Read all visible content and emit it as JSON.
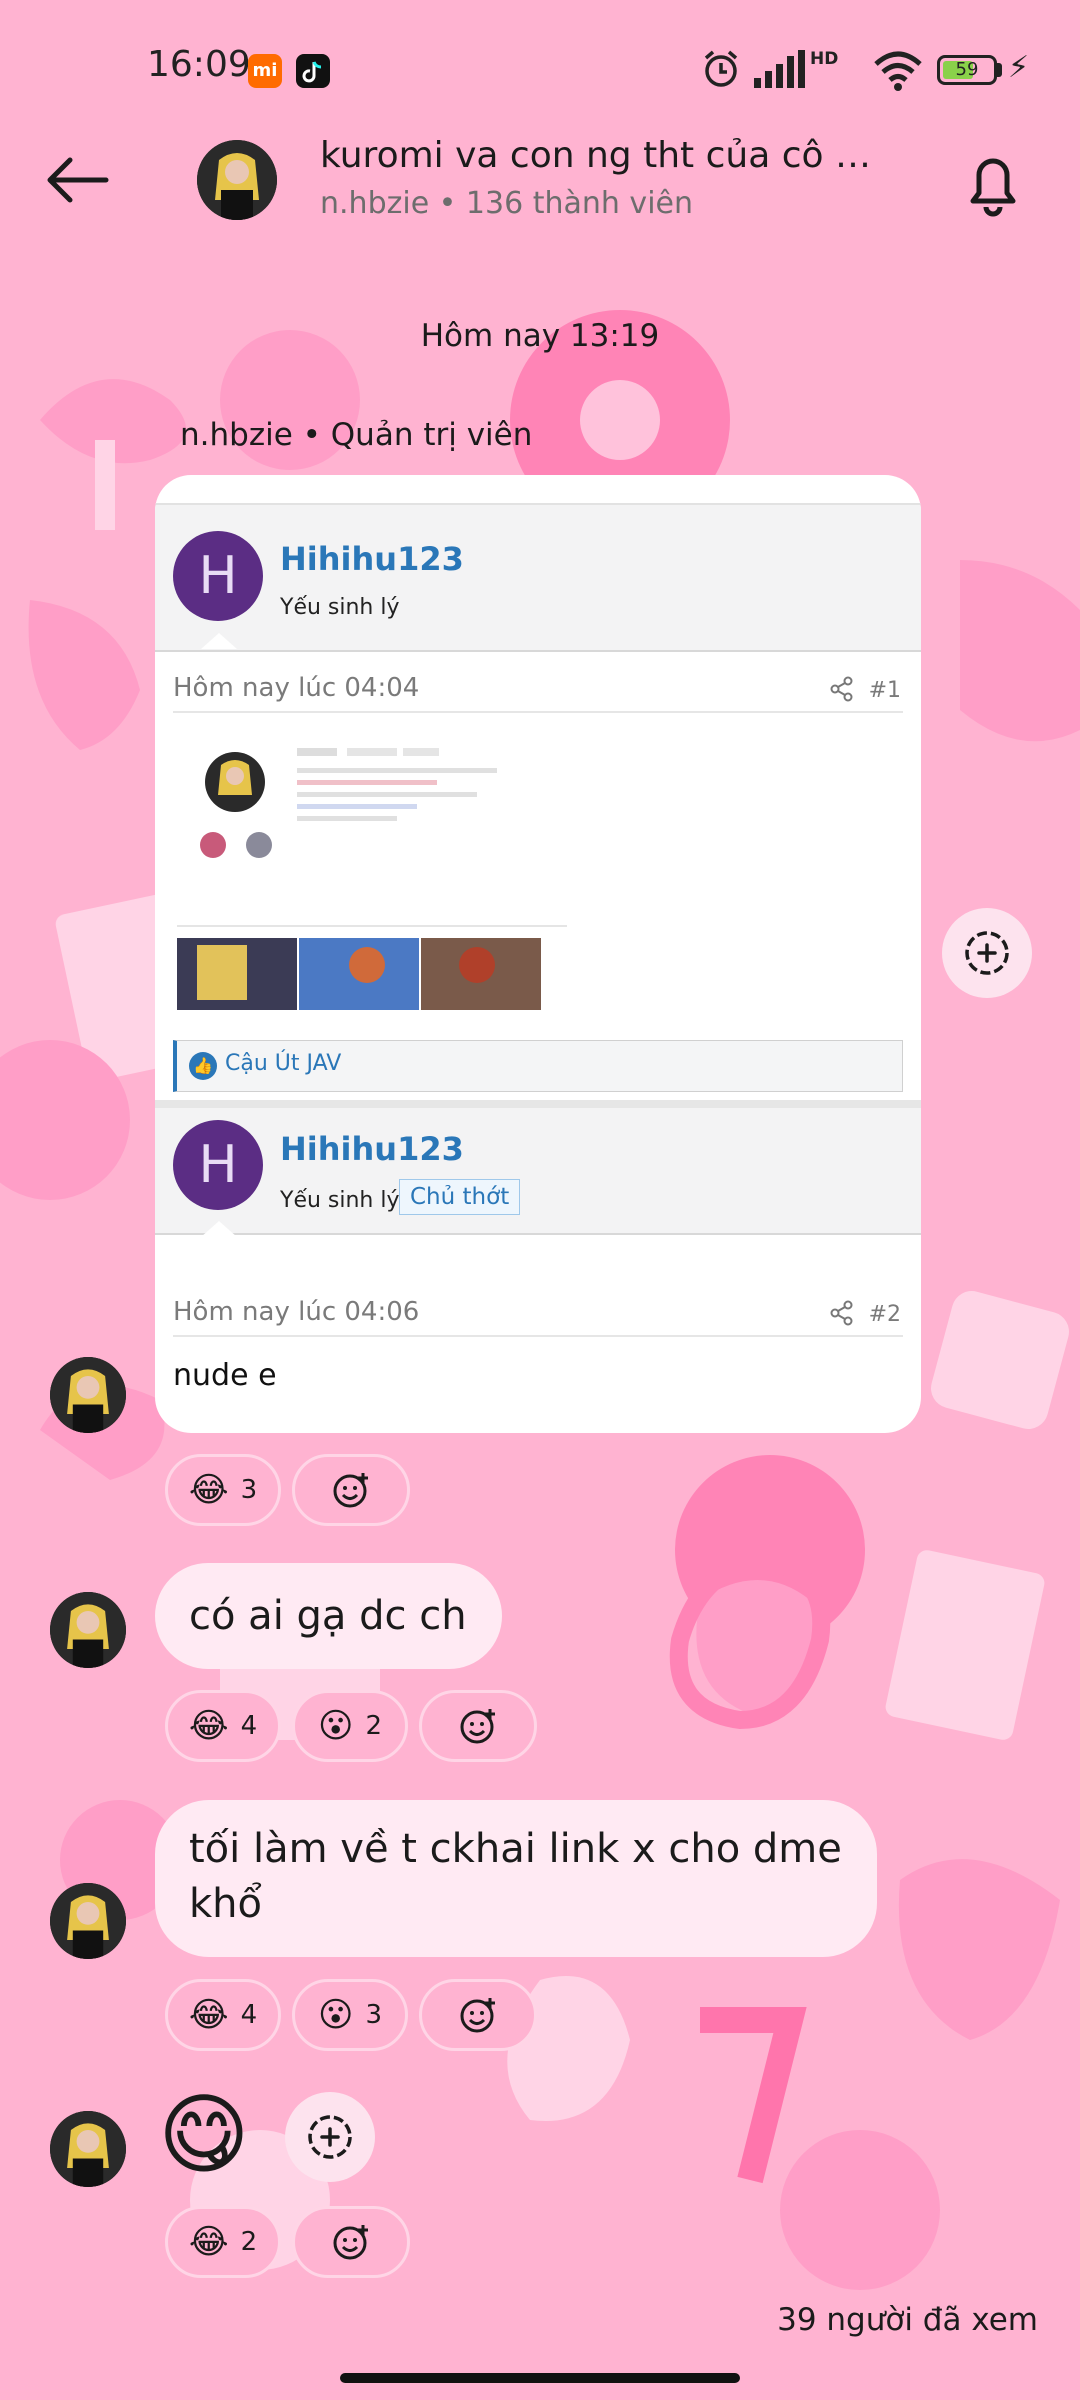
{
  "status_bar": {
    "time": "16:09",
    "mi_icon": "xiaomi-icon",
    "tiktok_icon": "tiktok-icon",
    "network": "HD",
    "battery": "59"
  },
  "header": {
    "title": "kuromi va con ng tht của cô ấ…",
    "subtitle": "n.hbzie • 136 thành viên"
  },
  "chat": {
    "date_separator": "Hôm nay 13:19",
    "sender_label": "n.hbzie • Quản trị viên",
    "shared_post": {
      "post1": {
        "avatar_letter": "H",
        "username": "Hihihu123",
        "role": "Yếu sinh lý",
        "date": "Hôm nay lúc 04:04",
        "number": "#1",
        "like_text": "Cậu Út JAV"
      },
      "post2": {
        "avatar_letter": "H",
        "username": "Hihihu123",
        "role": "Yếu sinh lý",
        "badge": "Chủ thớt",
        "date": "Hôm nay lúc 04:06",
        "number": "#2",
        "body": "nude e"
      }
    },
    "messages": [
      {
        "text": "",
        "reactions": [
          {
            "emoji": "😂",
            "count": "3"
          }
        ]
      },
      {
        "text": "có ai gạ dc ch",
        "reactions": [
          {
            "emoji": "😂",
            "count": "4"
          },
          {
            "emoji": "😮",
            "count": "2"
          }
        ]
      },
      {
        "text": "tối làm về t ckhai link x cho dme khổ",
        "reactions": [
          {
            "emoji": "😂",
            "count": "4"
          },
          {
            "emoji": "😮",
            "count": "3"
          }
        ]
      },
      {
        "emoji": "😋",
        "reactions": [
          {
            "emoji": "😂",
            "count": "2"
          }
        ]
      }
    ],
    "seen_text": "39 người đã xem"
  },
  "colors": {
    "background": "#ffb3d1",
    "bubble": "#ffeaf3",
    "link_blue": "#2a77b8",
    "post_avatar": "#5b2d84"
  }
}
